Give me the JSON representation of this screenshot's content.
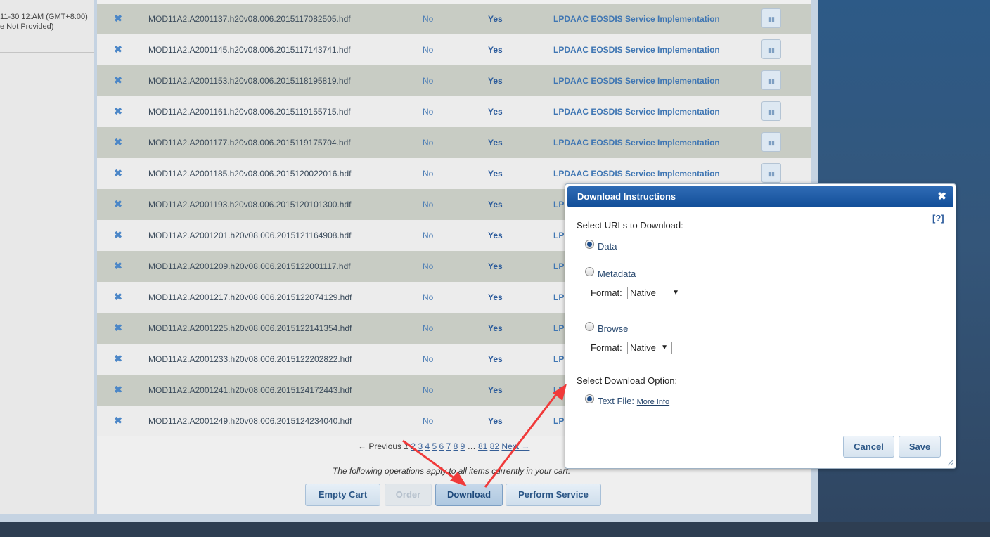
{
  "left_panel": {
    "date_line": "11-30 12:AM (GMT+8:00)",
    "status_line": "e Not Provided)"
  },
  "rows": [
    {
      "file": "MOD11A2.A2001137.h20v08.006.2015117082505.hdf",
      "col1": "No",
      "col2": "Yes",
      "provider": "LPDAAC EOSDIS Service Implementation"
    },
    {
      "file": "MOD11A2.A2001145.h20v08.006.2015117143741.hdf",
      "col1": "No",
      "col2": "Yes",
      "provider": "LPDAAC EOSDIS Service Implementation"
    },
    {
      "file": "MOD11A2.A2001153.h20v08.006.2015118195819.hdf",
      "col1": "No",
      "col2": "Yes",
      "provider": "LPDAAC EOSDIS Service Implementation"
    },
    {
      "file": "MOD11A2.A2001161.h20v08.006.2015119155715.hdf",
      "col1": "No",
      "col2": "Yes",
      "provider": "LPDAAC EOSDIS Service Implementation"
    },
    {
      "file": "MOD11A2.A2001177.h20v08.006.2015119175704.hdf",
      "col1": "No",
      "col2": "Yes",
      "provider": "LPDAAC EOSDIS Service Implementation"
    },
    {
      "file": "MOD11A2.A2001185.h20v08.006.2015120022016.hdf",
      "col1": "No",
      "col2": "Yes",
      "provider": "LPDAAC EOSDIS Service Implementation"
    },
    {
      "file": "MOD11A2.A2001193.h20v08.006.2015120101300.hdf",
      "col1": "No",
      "col2": "Yes",
      "provider": "LP"
    },
    {
      "file": "MOD11A2.A2001201.h20v08.006.2015121164908.hdf",
      "col1": "No",
      "col2": "Yes",
      "provider": "LP"
    },
    {
      "file": "MOD11A2.A2001209.h20v08.006.2015122001117.hdf",
      "col1": "No",
      "col2": "Yes",
      "provider": "LP"
    },
    {
      "file": "MOD11A2.A2001217.h20v08.006.2015122074129.hdf",
      "col1": "No",
      "col2": "Yes",
      "provider": "LP"
    },
    {
      "file": "MOD11A2.A2001225.h20v08.006.2015122141354.hdf",
      "col1": "No",
      "col2": "Yes",
      "provider": "LP"
    },
    {
      "file": "MOD11A2.A2001233.h20v08.006.2015122202822.hdf",
      "col1": "No",
      "col2": "Yes",
      "provider": "LP"
    },
    {
      "file": "MOD11A2.A2001241.h20v08.006.2015124172443.hdf",
      "col1": "No",
      "col2": "Yes",
      "provider": "LP"
    },
    {
      "file": "MOD11A2.A2001249.h20v08.006.2015124234040.hdf",
      "col1": "No",
      "col2": "Yes",
      "provider": "LP"
    }
  ],
  "row_icons": {
    "remove": "close-x-icon",
    "view": "granule-view-icon"
  },
  "pagination": {
    "previous": "← Previous",
    "current": "1",
    "pages": [
      "2",
      "3",
      "4",
      "5",
      "6",
      "7",
      "8",
      "9"
    ],
    "ellipsis": "…",
    "last_pages": [
      "81",
      "82"
    ],
    "next": "Next →"
  },
  "cart_note": "The following operations apply to all items currently in your cart.",
  "actions": {
    "empty_cart": "Empty Cart",
    "order": "Order",
    "download": "Download",
    "perform_service": "Perform Service"
  },
  "dialog": {
    "title": "Download Instructions",
    "help": "[?]",
    "select_urls_label": "Select URLs to Download:",
    "options": {
      "data": {
        "label": "Data",
        "selected": true
      },
      "metadata": {
        "label": "Metadata",
        "selected": false,
        "format_label": "Format:",
        "format_value": "Native"
      },
      "browse": {
        "label": "Browse",
        "selected": false,
        "format_label": "Format:",
        "format_value": "Native"
      }
    },
    "download_option_label": "Select Download Option:",
    "text_file": {
      "label": "Text File:",
      "selected": true,
      "more_info": "More Info"
    },
    "cancel": "Cancel",
    "save": "Save"
  },
  "colors": {
    "accent_blue": "#2a5a9b",
    "dialog_title": "#124e98",
    "annotation_arrow": "#f03a3a"
  }
}
